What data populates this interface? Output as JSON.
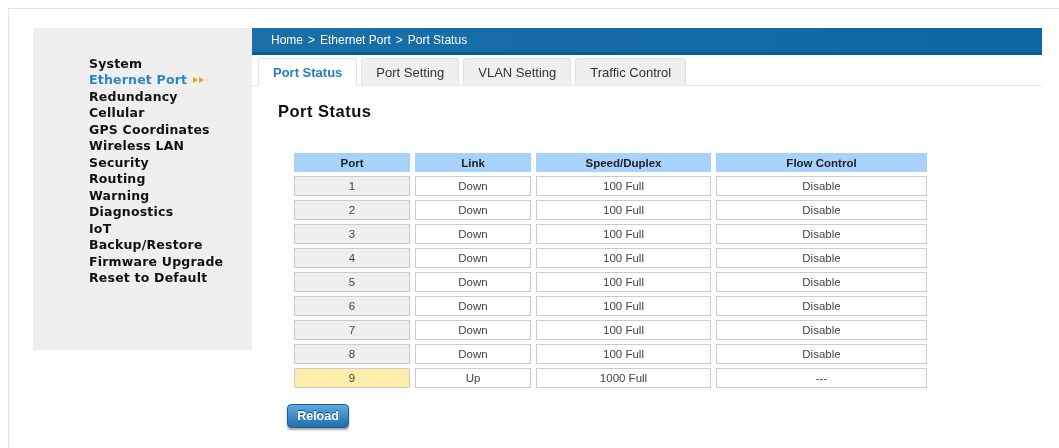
{
  "sidebar": {
    "items": [
      {
        "label": "System",
        "selected": false
      },
      {
        "label": "Ethernet Port",
        "selected": true
      },
      {
        "label": "Redundancy",
        "selected": false
      },
      {
        "label": "Cellular",
        "selected": false
      },
      {
        "label": "GPS Coordinates",
        "selected": false
      },
      {
        "label": "Wireless LAN",
        "selected": false
      },
      {
        "label": "Security",
        "selected": false
      },
      {
        "label": "Routing",
        "selected": false
      },
      {
        "label": "Warning",
        "selected": false
      },
      {
        "label": "Diagnostics",
        "selected": false
      },
      {
        "label": "IoT",
        "selected": false
      },
      {
        "label": "Backup/Restore",
        "selected": false
      },
      {
        "label": "Firmware Upgrade",
        "selected": false
      },
      {
        "label": "Reset to Default",
        "selected": false
      }
    ]
  },
  "breadcrumb": [
    "Home",
    ">",
    "Ethernet Port",
    ">",
    "Port Status"
  ],
  "tabs": [
    {
      "label": "Port Status",
      "selected": true
    },
    {
      "label": "Port Setting",
      "selected": false
    },
    {
      "label": "VLAN Setting",
      "selected": false
    },
    {
      "label": "Traffic Control",
      "selected": false
    }
  ],
  "heading": "Port Status",
  "table": {
    "columns": [
      "Port",
      "Link",
      "Speed/Duplex",
      "Flow Control"
    ],
    "rows": [
      {
        "port": "1",
        "link": "Down",
        "speed": "100 Full",
        "flow": "Disable",
        "highlighted": false
      },
      {
        "port": "2",
        "link": "Down",
        "speed": "100 Full",
        "flow": "Disable",
        "highlighted": false
      },
      {
        "port": "3",
        "link": "Down",
        "speed": "100 Full",
        "flow": "Disable",
        "highlighted": false
      },
      {
        "port": "4",
        "link": "Down",
        "speed": "100 Full",
        "flow": "Disable",
        "highlighted": false
      },
      {
        "port": "5",
        "link": "Down",
        "speed": "100 Full",
        "flow": "Disable",
        "highlighted": false
      },
      {
        "port": "6",
        "link": "Down",
        "speed": "100 Full",
        "flow": "Disable",
        "highlighted": false
      },
      {
        "port": "7",
        "link": "Down",
        "speed": "100 Full",
        "flow": "Disable",
        "highlighted": false
      },
      {
        "port": "8",
        "link": "Down",
        "speed": "100 Full",
        "flow": "Disable",
        "highlighted": false
      },
      {
        "port": "9",
        "link": "Up",
        "speed": "1000 Full",
        "flow": "---",
        "highlighted": true
      }
    ]
  },
  "buttons": [
    "Reload"
  ]
}
